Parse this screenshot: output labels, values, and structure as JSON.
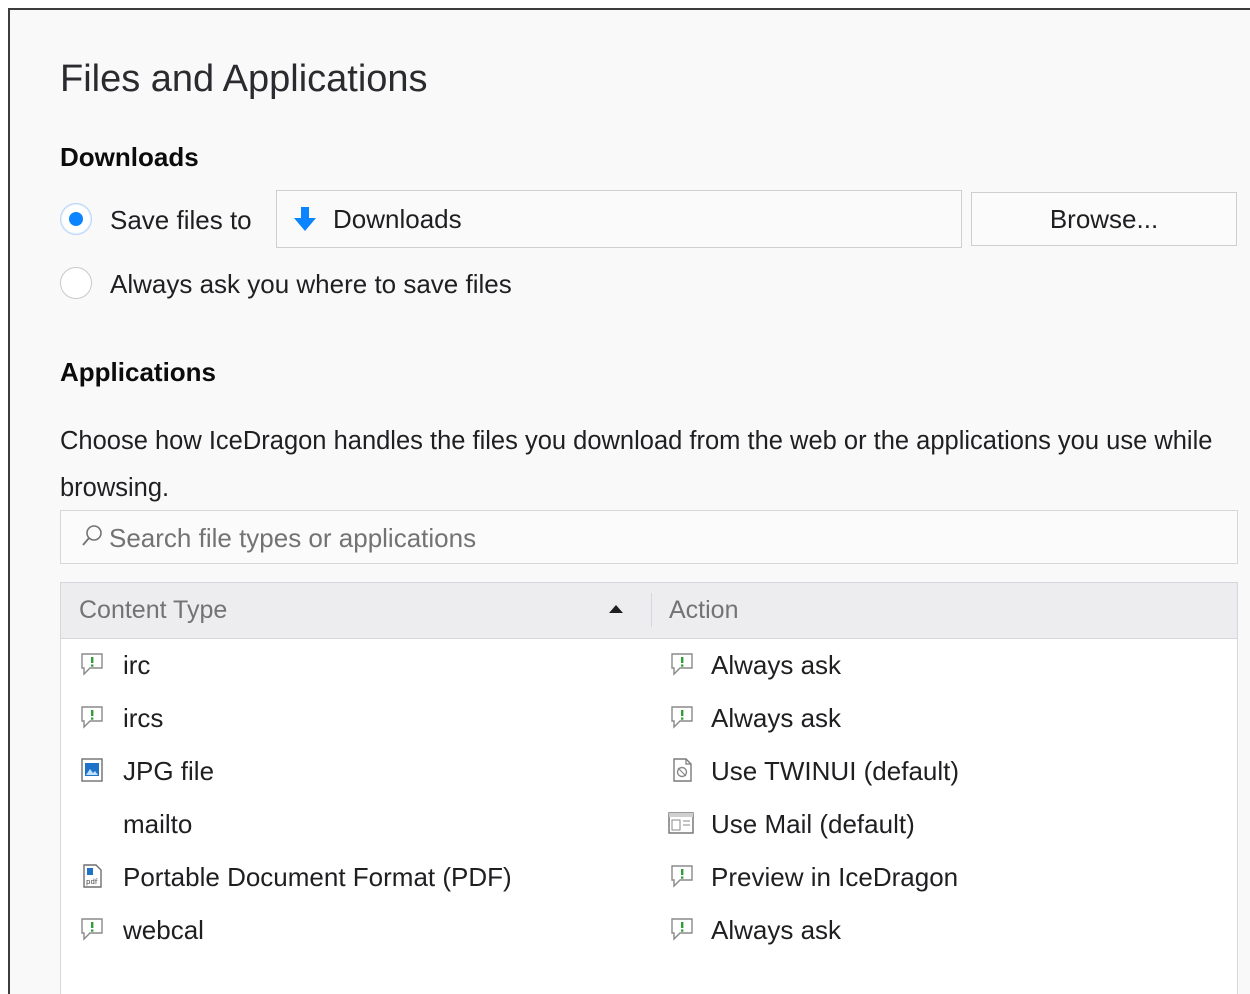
{
  "page": {
    "title": "Files and Applications"
  },
  "downloads": {
    "heading": "Downloads",
    "save_files_label": "Save files to",
    "folder_name": "Downloads",
    "browse_label": "Browse...",
    "always_ask_label": "Always ask you where to save files",
    "selected_option": "save_files_to"
  },
  "applications": {
    "heading": "Applications",
    "description": "Choose how IceDragon handles the files you download from the web or the applications you use while browsing.",
    "search_placeholder": "Search file types or applications",
    "columns": {
      "content_type": "Content Type",
      "action": "Action",
      "sort": "content_type-ascending"
    },
    "rows": [
      {
        "type": "irc",
        "type_icon": "chat-bubble-icon",
        "action": "Always ask",
        "action_icon": "chat-bubble-icon"
      },
      {
        "type": "ircs",
        "type_icon": "chat-bubble-icon",
        "action": "Always ask",
        "action_icon": "chat-bubble-icon"
      },
      {
        "type": "JPG file",
        "type_icon": "image-file-icon",
        "action": "Use TWINUI (default)",
        "action_icon": "twinui-app-icon"
      },
      {
        "type": "mailto",
        "type_icon": "",
        "action": "Use Mail (default)",
        "action_icon": "mail-app-icon"
      },
      {
        "type": "Portable Document Format (PDF)",
        "type_icon": "pdf-file-icon",
        "action": "Preview in IceDragon",
        "action_icon": "chat-bubble-icon"
      },
      {
        "type": "webcal",
        "type_icon": "chat-bubble-icon",
        "action": "Always ask",
        "action_icon": "chat-bubble-icon"
      }
    ]
  },
  "colors": {
    "accent": "#0a84ff",
    "background": "#f9f9fa",
    "header": "#ededf0"
  }
}
